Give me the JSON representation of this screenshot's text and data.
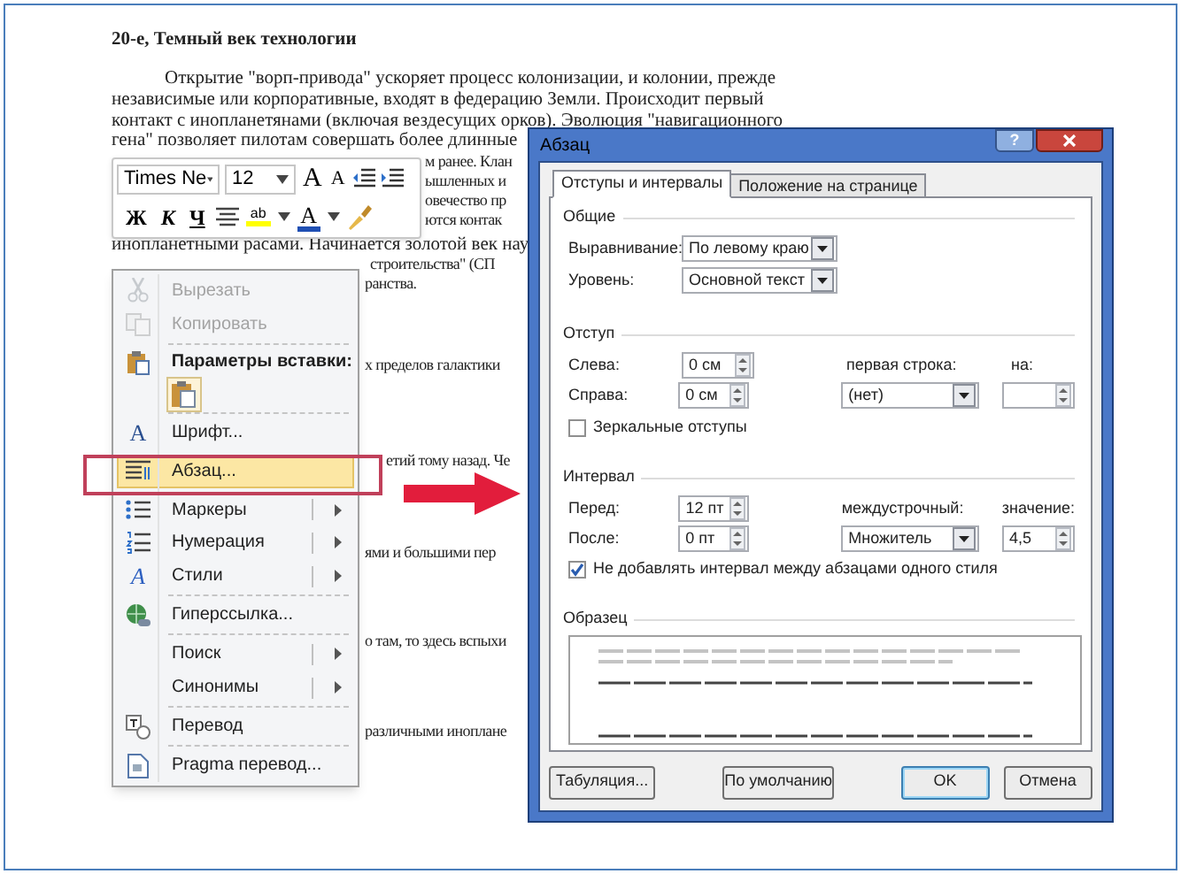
{
  "document": {
    "heading": "20-е, Темный век технологии",
    "lines": [
      "Открытие \"ворп-привода\" ускоряет процесс колонизации, и колонии, прежде",
      "независимые или корпоративные, входят в федерацию Земли. Происходит первый",
      "контакт с инопланетянами (включая вездесущих орков). Эволюция \"навигационного",
      "гена\" позволяет пилотам совершать более длинные",
      "м ранее. Клан",
      "ышленных и",
      "овечество пр",
      "ются контак",
      "инопланетными расами. Начинается золотой век нау",
      "строительства\" (СП",
      "ранства.",
      "х пределов галактики",
      "етий тому назад. Че",
      "ями и большими пер",
      "о там, то здесь вспыхи",
      "различными инопланe"
    ]
  },
  "mini_toolbar": {
    "font": "Times Ne",
    "size": "12",
    "grow_font": "A",
    "shrink_font": "A",
    "highlight": "ab",
    "font_color": "A",
    "format_buttons": [
      {
        "kind": "bold",
        "label": "Ж"
      },
      {
        "kind": "italic",
        "label": "К"
      },
      {
        "kind": "underline",
        "label": "Ч"
      }
    ]
  },
  "context_menu": {
    "items": [
      {
        "kind": "command",
        "label": "Вырезать",
        "disabled": true,
        "selected": false,
        "submenu": false,
        "separator_before": false
      },
      {
        "kind": "command",
        "label": "Копировать",
        "disabled": true,
        "selected": false,
        "submenu": false,
        "separator_before": false
      },
      {
        "kind": "header",
        "label": "Параметры вставки:",
        "disabled": false,
        "selected": false,
        "submenu": false,
        "separator_before": true
      },
      {
        "kind": "command",
        "label": "Шрифт...",
        "glyph": "A",
        "disabled": false,
        "selected": false,
        "submenu": false,
        "separator_before": true
      },
      {
        "kind": "command",
        "label": "Абзац...",
        "disabled": false,
        "selected": true,
        "submenu": false,
        "separator_before": false
      },
      {
        "kind": "command",
        "label": "Маркеры",
        "disabled": false,
        "selected": false,
        "submenu": true,
        "separator_before": false
      },
      {
        "kind": "command",
        "label": "Нумерация",
        "disabled": false,
        "selected": false,
        "submenu": true,
        "separator_before": false
      },
      {
        "kind": "command",
        "label": "Стили",
        "glyph": "A",
        "disabled": false,
        "selected": false,
        "submenu": true,
        "separator_before": false
      },
      {
        "kind": "command",
        "label": "Гиперссылка...",
        "disabled": false,
        "selected": false,
        "submenu": false,
        "separator_before": true
      },
      {
        "kind": "command",
        "label": "Поиск",
        "disabled": false,
        "selected": false,
        "submenu": true,
        "separator_before": true
      },
      {
        "kind": "command",
        "label": "Синонимы",
        "disabled": false,
        "selected": false,
        "submenu": true,
        "separator_before": false
      },
      {
        "kind": "command",
        "label": "Перевод",
        "disabled": false,
        "selected": false,
        "submenu": false,
        "separator_before": true
      },
      {
        "kind": "command",
        "label": "Pragma перевод...",
        "disabled": false,
        "selected": false,
        "submenu": false,
        "separator_before": true
      }
    ]
  },
  "dialog": {
    "title": "Абзац",
    "help": "?",
    "tabs": [
      {
        "label": "Отступы и интервалы",
        "selected": true
      },
      {
        "label": "Положение на странице",
        "selected": false
      }
    ],
    "general": {
      "legend": "Общие",
      "alignment": {
        "label": "Выравнивание:",
        "value": "По левому краю"
      },
      "level": {
        "label": "Уровень:",
        "value": "Основной текст"
      }
    },
    "indent": {
      "legend": "Отступ",
      "left": {
        "label": "Слева:",
        "value": "0 см"
      },
      "right": {
        "label": "Справа:",
        "value": "0 см"
      },
      "first_line": {
        "label": "первая строка:",
        "value": "(нет)"
      },
      "by": {
        "label": "на:"
      },
      "mirror": {
        "label": "Зеркальные отступы",
        "checked": false
      }
    },
    "spacing": {
      "legend": "Интервал",
      "before": {
        "label": "Перед:",
        "value": "12 пт"
      },
      "after": {
        "label": "После:",
        "value": "0 пт"
      },
      "line_spacing": {
        "label": "междустрочный:",
        "value": "Множитель"
      },
      "at": {
        "label": "значение:",
        "value": "4,5"
      },
      "dont_add": {
        "label": "Не добавлять интервал между абзацами одного стиля",
        "checked": true
      }
    },
    "preview": {
      "legend": "Образец"
    },
    "buttons": [
      {
        "label": "Табуляция...",
        "default": false
      },
      {
        "label": "По умолчанию",
        "default": false
      },
      {
        "label": "OK",
        "default": true
      },
      {
        "label": "Отмена",
        "default": false
      }
    ]
  }
}
